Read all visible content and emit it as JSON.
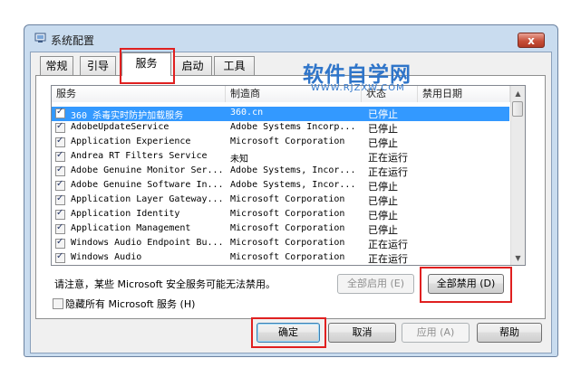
{
  "window": {
    "title": "系统配置",
    "icon": "system-config-icon",
    "close_label": "x"
  },
  "tabs": [
    {
      "label": "常规",
      "active": false
    },
    {
      "label": "引导",
      "active": false
    },
    {
      "label": "服务",
      "active": true
    },
    {
      "label": "启动",
      "active": false
    },
    {
      "label": "工具",
      "active": false
    }
  ],
  "watermark": {
    "title": "软件自学网",
    "url": "WWW.RJZXW.COM"
  },
  "services": {
    "columns": [
      "服务",
      "制造商",
      "状态",
      "禁用日期"
    ],
    "rows": [
      {
        "name": "360 杀毒实时防护加载服务",
        "maker": "360.cn",
        "status": "已停止",
        "checked": true,
        "selected": true
      },
      {
        "name": "AdobeUpdateService",
        "maker": "Adobe Systems Incorp...",
        "status": "已停止",
        "checked": true,
        "selected": false
      },
      {
        "name": "Application Experience",
        "maker": "Microsoft Corporation",
        "status": "已停止",
        "checked": true,
        "selected": false
      },
      {
        "name": "Andrea RT Filters Service",
        "maker": "未知",
        "status": "正在运行",
        "checked": true,
        "selected": false
      },
      {
        "name": "Adobe Genuine Monitor Ser...",
        "maker": "Adobe Systems, Incor...",
        "status": "正在运行",
        "checked": true,
        "selected": false
      },
      {
        "name": "Adobe Genuine Software In...",
        "maker": "Adobe Systems, Incor...",
        "status": "已停止",
        "checked": true,
        "selected": false
      },
      {
        "name": "Application Layer Gateway...",
        "maker": "Microsoft Corporation",
        "status": "已停止",
        "checked": true,
        "selected": false
      },
      {
        "name": "Application Identity",
        "maker": "Microsoft Corporation",
        "status": "已停止",
        "checked": true,
        "selected": false
      },
      {
        "name": "Application Management",
        "maker": "Microsoft Corporation",
        "status": "已停止",
        "checked": true,
        "selected": false
      },
      {
        "name": "Windows Audio Endpoint Bu...",
        "maker": "Microsoft Corporation",
        "status": "正在运行",
        "checked": true,
        "selected": false
      },
      {
        "name": "Windows Audio",
        "maker": "Microsoft Corporation",
        "status": "正在运行",
        "checked": true,
        "selected": false
      }
    ]
  },
  "note": "请注意，某些 Microsoft 安全服务可能无法禁用。",
  "buttons": {
    "enable_all": "全部启用 (E)",
    "disable_all": "全部禁用 (D)",
    "ok": "确定",
    "cancel": "取消",
    "apply": "应用 (A)",
    "help": "帮助"
  },
  "hide_ms": {
    "label": "隐藏所有 Microsoft 服务 (H)",
    "checked": false
  },
  "colors": {
    "selection": "#3399ff",
    "highlight_box": "#e02020",
    "watermark": "#2f75c9"
  }
}
